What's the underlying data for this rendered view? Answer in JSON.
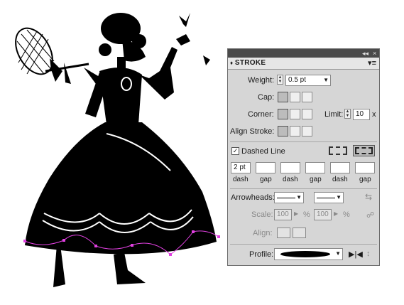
{
  "panel": {
    "title": "STROKE",
    "collapse_glyph": "◂◂",
    "close_glyph": "×",
    "menu_glyph": "▾≡",
    "weight": {
      "label": "Weight:",
      "value": "0.5 pt"
    },
    "cap": {
      "label": "Cap:"
    },
    "corner": {
      "label": "Corner:"
    },
    "limit": {
      "label": "Limit:",
      "value": "10",
      "unit": "x"
    },
    "align_stroke": {
      "label": "Align Stroke:"
    },
    "dashed_line": {
      "label": "Dashed Line",
      "checked": true,
      "check_glyph": "✓"
    },
    "dash_fields": [
      "2 pt",
      "",
      "",
      "",
      "",
      ""
    ],
    "dash_labels": [
      "dash",
      "gap",
      "dash",
      "gap",
      "dash",
      "gap"
    ],
    "arrowheads": {
      "label": "Arrowheads:"
    },
    "scale": {
      "label": "Scale:",
      "start": "100",
      "end": "100",
      "unit": "%"
    },
    "align": {
      "label": "Align:"
    },
    "profile": {
      "label": "Profile:"
    }
  },
  "canvas": {
    "selection_color": "#e040e0"
  }
}
